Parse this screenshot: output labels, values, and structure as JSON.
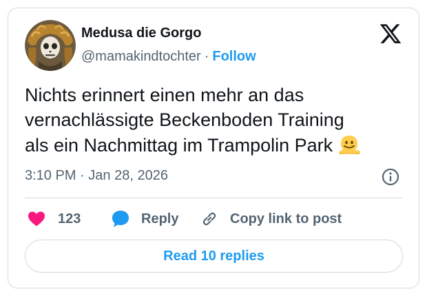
{
  "author": {
    "display_name": "Medusa die Gorgo",
    "handle": "@mamakindtochter",
    "separator": "·",
    "follow_label": "Follow"
  },
  "brand": {
    "icon": "x-logo-icon"
  },
  "tweet": {
    "lines": [
      "Nichts erinnert einen mehr an das",
      "vernachlässigte Beckenboden Training",
      "als ein Nachmittag im Trampolin Park"
    ],
    "emoji": "melting-face-icon",
    "time": "3:10 PM",
    "separator": "·",
    "date": "Jan 28, 2026"
  },
  "actions": {
    "like_count": "123",
    "reply_label": "Reply",
    "copy_label": "Copy link to post"
  },
  "read_replies_label": "Read 10 replies",
  "colors": {
    "accent": "#1d9bf0",
    "like": "#f91880",
    "text": "#0f1419",
    "muted": "#536471",
    "border": "#cfd9de"
  }
}
